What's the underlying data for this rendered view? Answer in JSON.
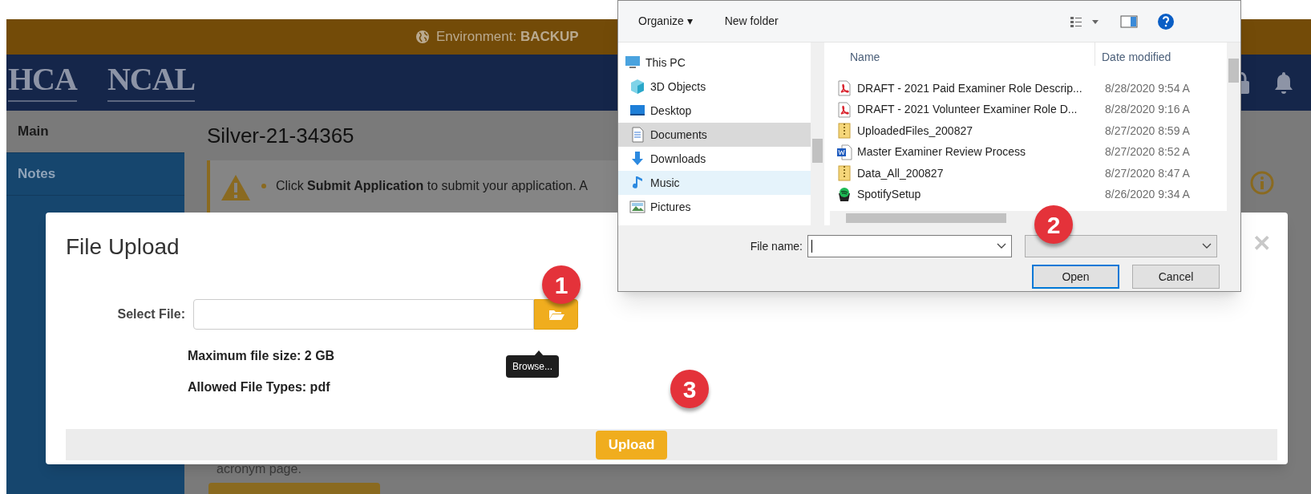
{
  "environment_bar": {
    "label": "Environment:",
    "value": "BACKUP"
  },
  "header": {
    "logos": [
      "HCA",
      "NCAL"
    ]
  },
  "sidebar": {
    "items": [
      {
        "label": "Main",
        "selected": false
      },
      {
        "label": "Notes",
        "selected": true
      }
    ]
  },
  "page": {
    "title": "Silver-21-34365",
    "alert": "Click **Submit Application** to submit your application. A",
    "footer_text": "acronym page."
  },
  "modal": {
    "title": "File Upload",
    "close": "✕",
    "select_label": "Select File:",
    "tooltip": "Browse...",
    "notes": [
      "Maximum file size: 2 GB",
      "Allowed File Types: pdf"
    ],
    "upload": "Upload"
  },
  "callouts": [
    "1",
    "2",
    "3"
  ],
  "file_dialog": {
    "toolbar": {
      "organize": "Organize ▾",
      "new_folder": "New folder"
    },
    "nav": [
      {
        "label": "This PC",
        "kind": "pc",
        "selected": false,
        "hovered": false
      },
      {
        "label": "3D Objects",
        "kind": "cube",
        "selected": false,
        "hovered": false
      },
      {
        "label": "Desktop",
        "kind": "desktop",
        "selected": false,
        "hovered": false
      },
      {
        "label": "Documents",
        "kind": "documents",
        "selected": true,
        "hovered": false
      },
      {
        "label": "Downloads",
        "kind": "downloads",
        "selected": false,
        "hovered": false
      },
      {
        "label": "Music",
        "kind": "music",
        "selected": false,
        "hovered": true
      },
      {
        "label": "Pictures",
        "kind": "pictures",
        "selected": false,
        "hovered": false
      }
    ],
    "columns": [
      "Name",
      "Date modified"
    ],
    "files": [
      {
        "name": "DRAFT - 2021 Paid Examiner Role Descrip...",
        "date": "8/28/2020 9:54 A",
        "kind": "pdf"
      },
      {
        "name": "DRAFT - 2021 Volunteer Examiner Role D...",
        "date": "8/28/2020 9:16 A",
        "kind": "pdf"
      },
      {
        "name": "UploadedFiles_200827",
        "date": "8/27/2020 8:59 A",
        "kind": "zip"
      },
      {
        "name": "Master Examiner Review Process",
        "date": "8/27/2020 8:52 A",
        "kind": "word"
      },
      {
        "name": "Data_All_200827",
        "date": "8/27/2020 8:47 A",
        "kind": "zip"
      },
      {
        "name": "SpotifySetup",
        "date": "8/26/2020 9:34 A",
        "kind": "app"
      }
    ],
    "file_name_label": "File name:",
    "buttons": [
      {
        "label": "Open",
        "default": true
      },
      {
        "label": "Cancel",
        "default": false
      }
    ]
  }
}
